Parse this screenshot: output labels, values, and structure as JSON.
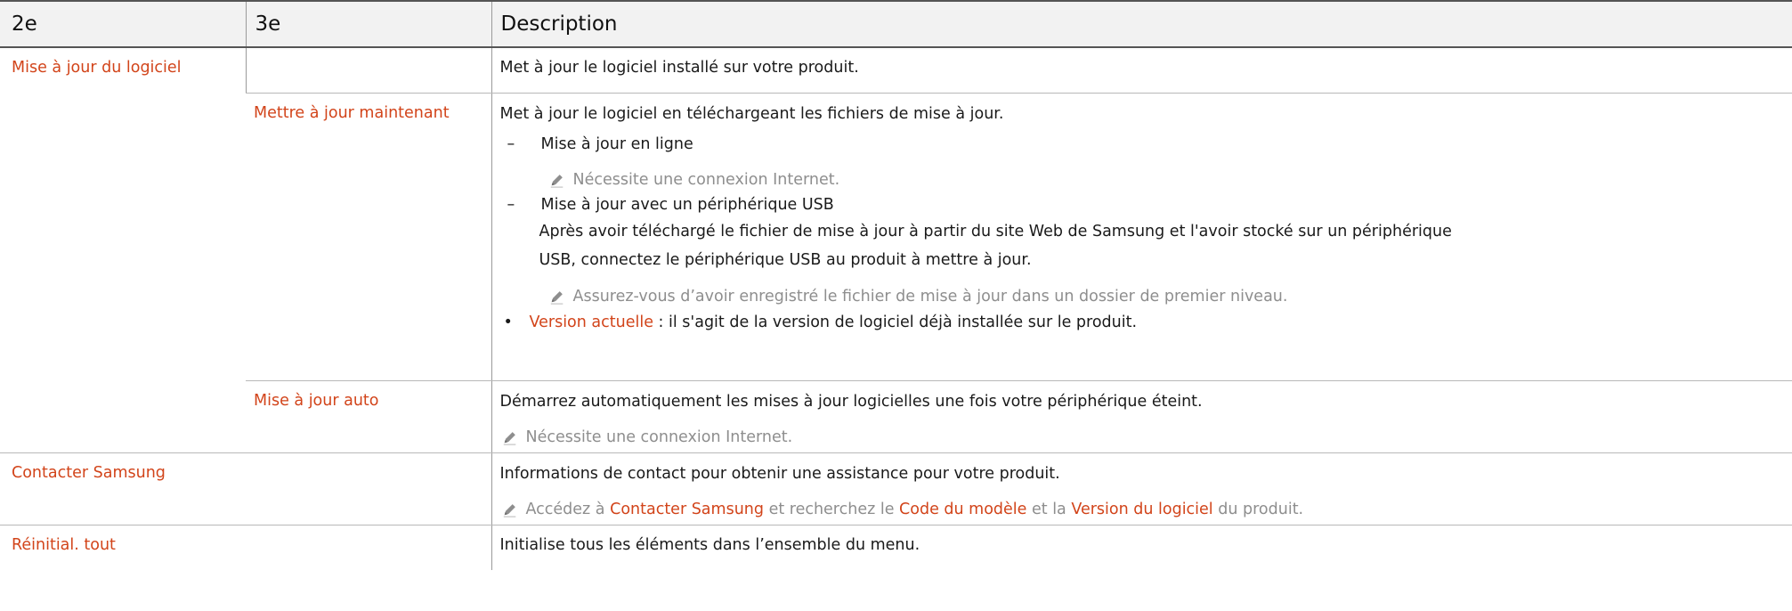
{
  "header": {
    "col2": "2e",
    "col3": "3e",
    "col4": "Description"
  },
  "rows": {
    "software_update": {
      "label": "Mise à jour du logiciel",
      "desc": "Met à jour le logiciel installé sur votre produit."
    },
    "update_now": {
      "label": "Mettre à jour maintenant",
      "desc": "Met à jour le logiciel en téléchargeant les fichiers de mise à jour.",
      "dash1": "–",
      "online": "Mise à jour en ligne",
      "online_note": "Nécessite une connexion Internet.",
      "dash2": "–",
      "usb": "Mise à jour avec un périphérique USB",
      "usb_text1": "Après avoir téléchargé le fichier de mise à jour à partir du site Web de Samsung et l'avoir stocké sur un périphérique",
      "usb_text2": "USB, connectez le périphérique USB au produit à mettre à jour.",
      "usb_note": "Assurez-vous d’avoir enregistré le fichier de mise à jour dans un dossier de premier niveau.",
      "bullet": "•",
      "version_label": "Version actuelle",
      "version_text": " : il s'agit de la version de logiciel déjà installée sur le produit."
    },
    "auto_update": {
      "label": "Mise à jour auto",
      "desc": "Démarrez automatiquement les mises à jour logicielles une fois votre périphérique éteint.",
      "note": "Nécessite une connexion Internet."
    },
    "contact": {
      "label": "Contacter Samsung",
      "desc": "Informations de contact pour obtenir une assistance pour votre produit.",
      "note_a": "Accédez à ",
      "note_link1": "Contacter Samsung",
      "note_b": " et recherchez le ",
      "note_link2": "Code du modèle",
      "note_c": " et la ",
      "note_link3": "Version du logiciel",
      "note_d": " du produit."
    },
    "reset": {
      "label": "Réinitial. tout",
      "desc": "Initialise tous les éléments dans l’ensemble du menu."
    }
  },
  "colors": {
    "accent": "#d2441a",
    "note_gray": "#8e8e8e",
    "header_bg": "#f2f2f2"
  },
  "icons": {
    "note": "pencil-icon"
  }
}
